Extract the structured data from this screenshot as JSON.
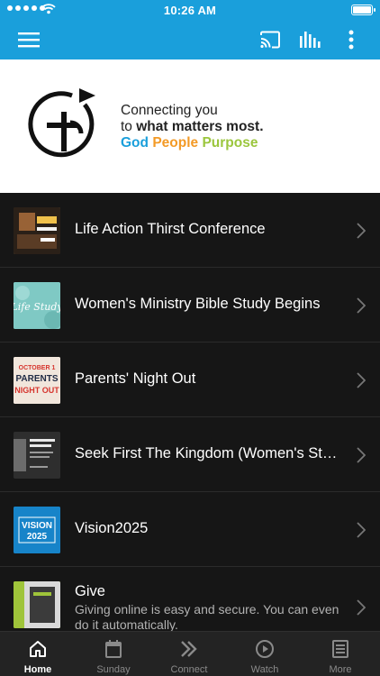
{
  "status_bar": {
    "time": "10:26 AM"
  },
  "app_bar": {
    "menu_icon": "hamburger-menu-icon",
    "cast_icon": "cast-icon",
    "audio_icon": "audio-bars-icon",
    "more_icon": "vertical-dots-icon"
  },
  "hero": {
    "line1": "Connecting you",
    "line2_prefix": "to",
    "line2_bold": "what matters most.",
    "word1": "God",
    "word2": "People",
    "word3": "Purpose",
    "colors": {
      "god": "#1a9fdb",
      "people": "#f39a26",
      "purpose": "#9bc63d"
    }
  },
  "list": {
    "items": [
      {
        "title": "Life Action Thirst Conference"
      },
      {
        "title": "Women's Ministry Bible Study Begins"
      },
      {
        "title": "Parents' Night Out"
      },
      {
        "title": "Seek First The Kingdom (Women's Study)"
      },
      {
        "title": "Vision2025"
      },
      {
        "title": "Give",
        "subtitle": "Giving online is easy and secure. You can even do it automatically."
      }
    ],
    "thumb_text": {
      "vision_1": "VISION",
      "vision_2": "2025",
      "parents_1": "OCTOBER 1",
      "parents_2": "PARENTS",
      "parents_3": "NIGHT OUT",
      "life": "Life Study"
    }
  },
  "tab_bar": {
    "tabs": [
      {
        "label": "Home",
        "icon": "home-icon",
        "active": true
      },
      {
        "label": "Sunday",
        "icon": "calendar-icon",
        "active": false
      },
      {
        "label": "Connect",
        "icon": "double-chevron-icon",
        "active": false
      },
      {
        "label": "Watch",
        "icon": "play-circle-icon",
        "active": false
      },
      {
        "label": "More",
        "icon": "news-icon",
        "active": false
      }
    ]
  },
  "theme": {
    "accent": "#1a9fdb",
    "list_bg": "#161616",
    "tabbar_bg": "#232323"
  }
}
